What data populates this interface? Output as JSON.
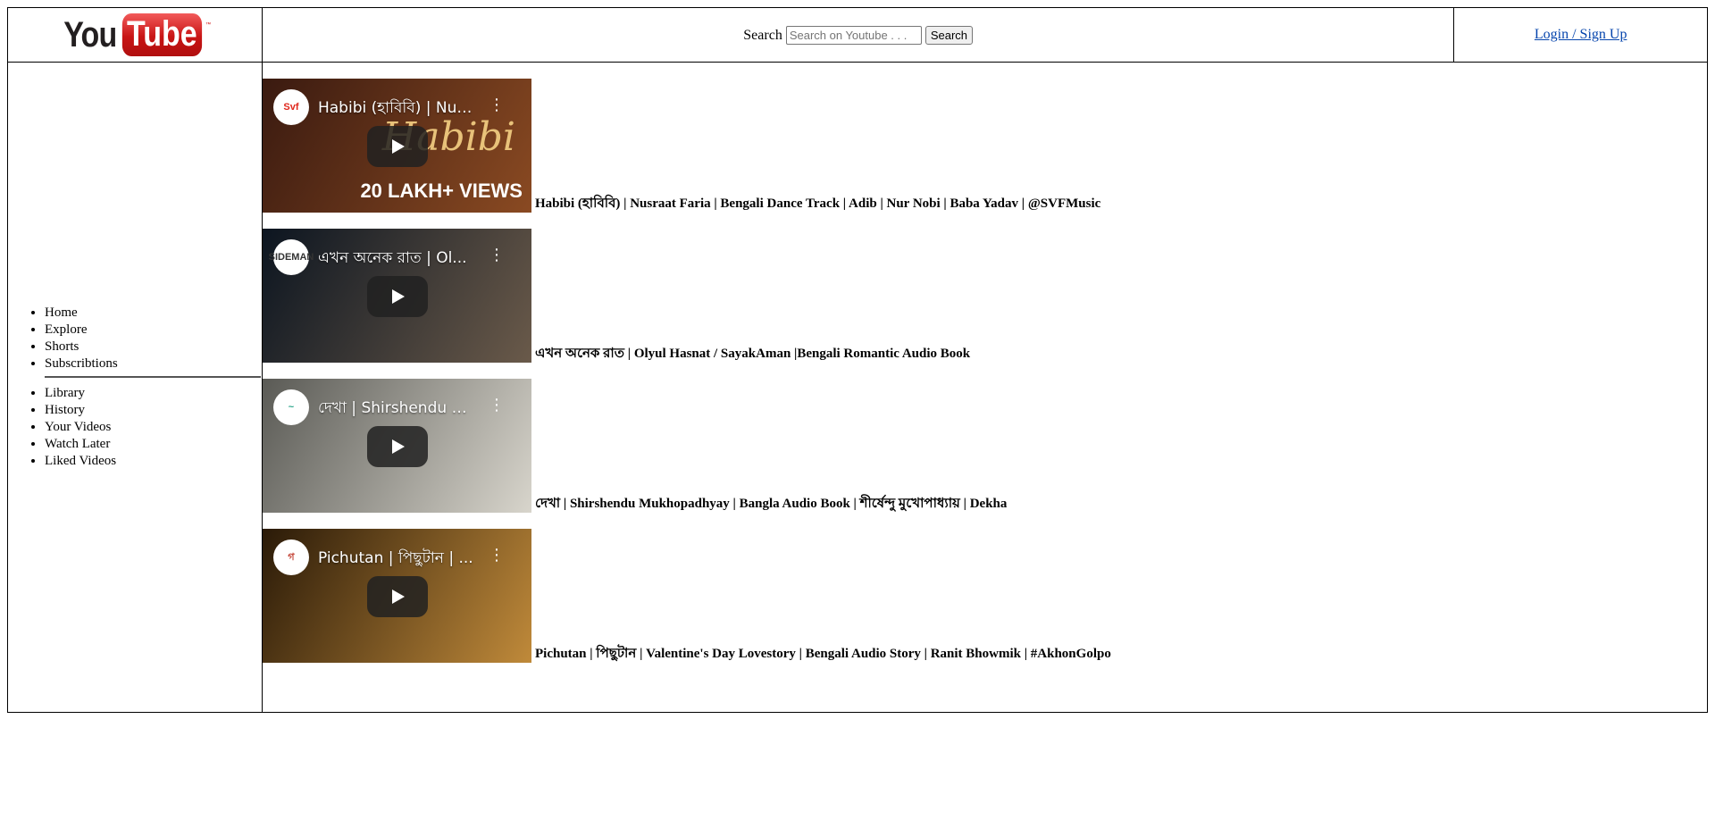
{
  "header": {
    "logo": {
      "you": "You",
      "tube": "Tube",
      "tm": "™"
    },
    "search": {
      "label": "Search",
      "placeholder": "Search on Youtube . . .",
      "button_label": "Search"
    },
    "login_label": "Login / Sign Up"
  },
  "sidebar": {
    "primary_items": [
      {
        "label": "Home"
      },
      {
        "label": "Explore"
      },
      {
        "label": "Shorts"
      },
      {
        "label": "Subscribtions"
      }
    ],
    "secondary_items": [
      {
        "label": "Library"
      },
      {
        "label": "History"
      },
      {
        "label": "Your Videos"
      },
      {
        "label": "Watch Later"
      },
      {
        "label": "Liked Videos"
      }
    ]
  },
  "videos": [
    {
      "title": "Habibi (হাবিবি) | Nusraat Faria | Bengali Dance Track | Adib | Nur Nobi | Baba Yadav | @SVFMusic",
      "embed_title": "Habibi (হাবিবি) | Nus...",
      "channel_mark": "Svf",
      "overlay_script": "Habibi",
      "overlay_badge": "20 LAKH+ VIEWS",
      "colors": {
        "bg_from": "#3a1a10",
        "bg_to": "#8a4a22",
        "chan": "#e0261b"
      }
    },
    {
      "title": "এখন অনেক রাত | Olyul Hasnat / SayakAman |Bengali Romantic Audio Book",
      "embed_title": "এখন অনেক রাত | Ol...",
      "channel_mark": "SIDEMAN",
      "overlay_script": "",
      "overlay_badge": "",
      "colors": {
        "bg_from": "#0c1520",
        "bg_to": "#6a5a4a",
        "chan": "#333333"
      }
    },
    {
      "title": "দেখা | Shirshendu Mukhopadhyay | Bangla Audio Book | শীর্ষেন্দু মুখোপাধ্যায় | Dekha",
      "embed_title": "দেখা | Shirshendu M...",
      "channel_mark": "~",
      "overlay_script": "",
      "overlay_badge": "",
      "colors": {
        "bg_from": "#5a5a55",
        "bg_to": "#d8d5cc",
        "chan": "#2aa58a"
      }
    },
    {
      "title": "Pichutan | পিছুটান | Valentine's Day Lovestory | Bengali Audio Story | Ranit Bhowmik | #AkhonGolpo",
      "embed_title": "Pichutan | পিছুটান | ...",
      "channel_mark": "গ",
      "overlay_script": "",
      "overlay_badge": "",
      "colors": {
        "bg_from": "#2a1a08",
        "bg_to": "#c08a3a",
        "chan": "#c0392b"
      }
    }
  ]
}
